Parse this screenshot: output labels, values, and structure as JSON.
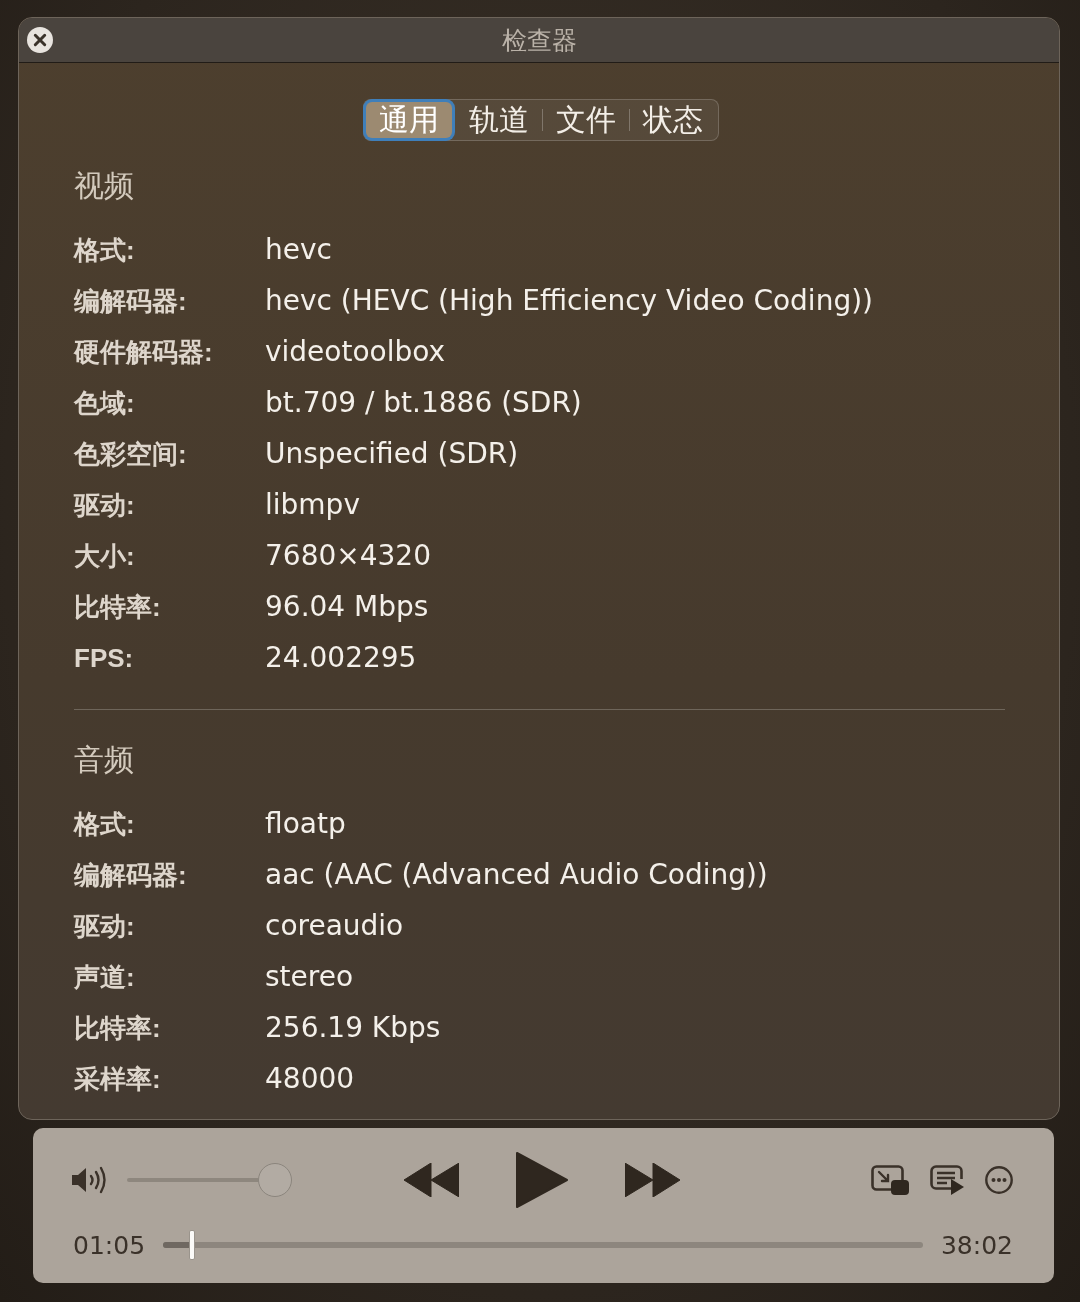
{
  "window": {
    "title": "检查器"
  },
  "tabs": [
    {
      "label": "通用",
      "selected": true
    },
    {
      "label": "轨道",
      "selected": false
    },
    {
      "label": "文件",
      "selected": false
    },
    {
      "label": "状态",
      "selected": false
    }
  ],
  "sections": [
    {
      "title": "视频",
      "rows": [
        {
          "label": "格式:",
          "value": "hevc"
        },
        {
          "label": "编解码器:",
          "value": "hevc (HEVC (High Efficiency Video Coding))"
        },
        {
          "label": "硬件解码器:",
          "value": "videotoolbox"
        },
        {
          "label": "色域:",
          "value": "bt.709 / bt.1886 (SDR)"
        },
        {
          "label": "色彩空间:",
          "value": "Unspecified (SDR)"
        },
        {
          "label": "驱动:",
          "value": "libmpv"
        },
        {
          "label": "大小:",
          "value": "7680×4320"
        },
        {
          "label": "比特率:",
          "value": "96.04 Mbps"
        },
        {
          "label": "FPS:",
          "value": "24.002295"
        }
      ]
    },
    {
      "title": "音频",
      "rows": [
        {
          "label": "格式:",
          "value": "floatp"
        },
        {
          "label": "编解码器:",
          "value": "aac (AAC (Advanced Audio Coding))"
        },
        {
          "label": "驱动:",
          "value": "coreaudio"
        },
        {
          "label": "声道:",
          "value": "stereo"
        },
        {
          "label": "比特率:",
          "value": "256.19 Kbps"
        },
        {
          "label": "采样率:",
          "value": "48000"
        }
      ]
    }
  ],
  "player": {
    "volume": {
      "level": 1
    },
    "playing": false,
    "elapsed": "01:05",
    "progress": {
      "level": 0.035
    },
    "duration": "38:02"
  }
}
